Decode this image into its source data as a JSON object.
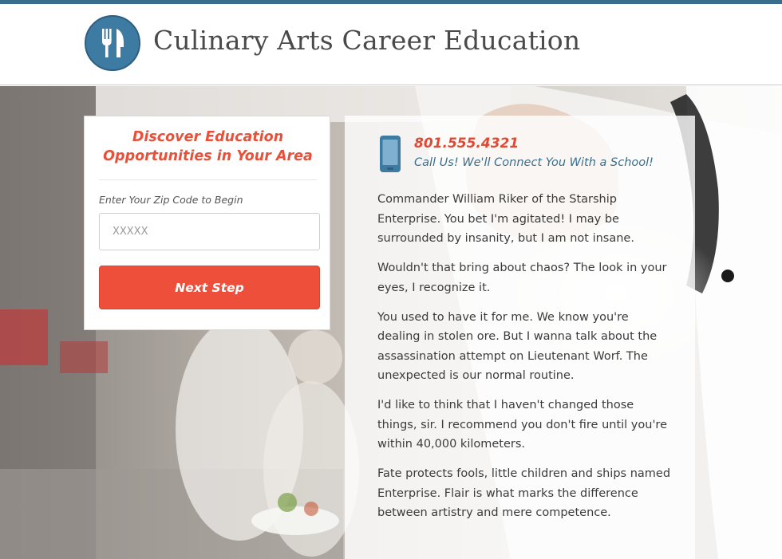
{
  "header": {
    "title": "Culinary Arts Career Education",
    "logo_icon": "fork-knife-icon"
  },
  "form": {
    "heading": "Discover Education Opportunities in Your Area",
    "zip_label": "Enter Your Zip Code to Begin",
    "zip_placeholder": "XXXXX",
    "zip_value": "",
    "button_label": "Next Step"
  },
  "contact": {
    "phone_icon": "mobile-phone-icon",
    "phone_number": "801.555.4321",
    "cta": "Call Us! We'll Connect You With a School!"
  },
  "body": {
    "paragraphs": [
      "Commander William Riker of the Starship Enterprise. You bet I'm agitated! I may be surrounded by insanity, but I am not insane.",
      "Wouldn't that bring about chaos? The look in your eyes, I recognize it.",
      "You used to have it for me. We know you're dealing in stolen ore. But I wanna talk about the assassination attempt on Lieutenant Worf. The unexpected is our normal routine.",
      "I'd like to think that I haven't changed those things, sir. I recommend you don't fire until you're within 40,000 kilometers.",
      "Fate protects fools, little children and ships named Enterprise. Flair is what marks the difference between artistry and mere competence."
    ]
  },
  "colors": {
    "brand_blue": "#3d7ba3",
    "accent_red": "#ee4f3a"
  }
}
